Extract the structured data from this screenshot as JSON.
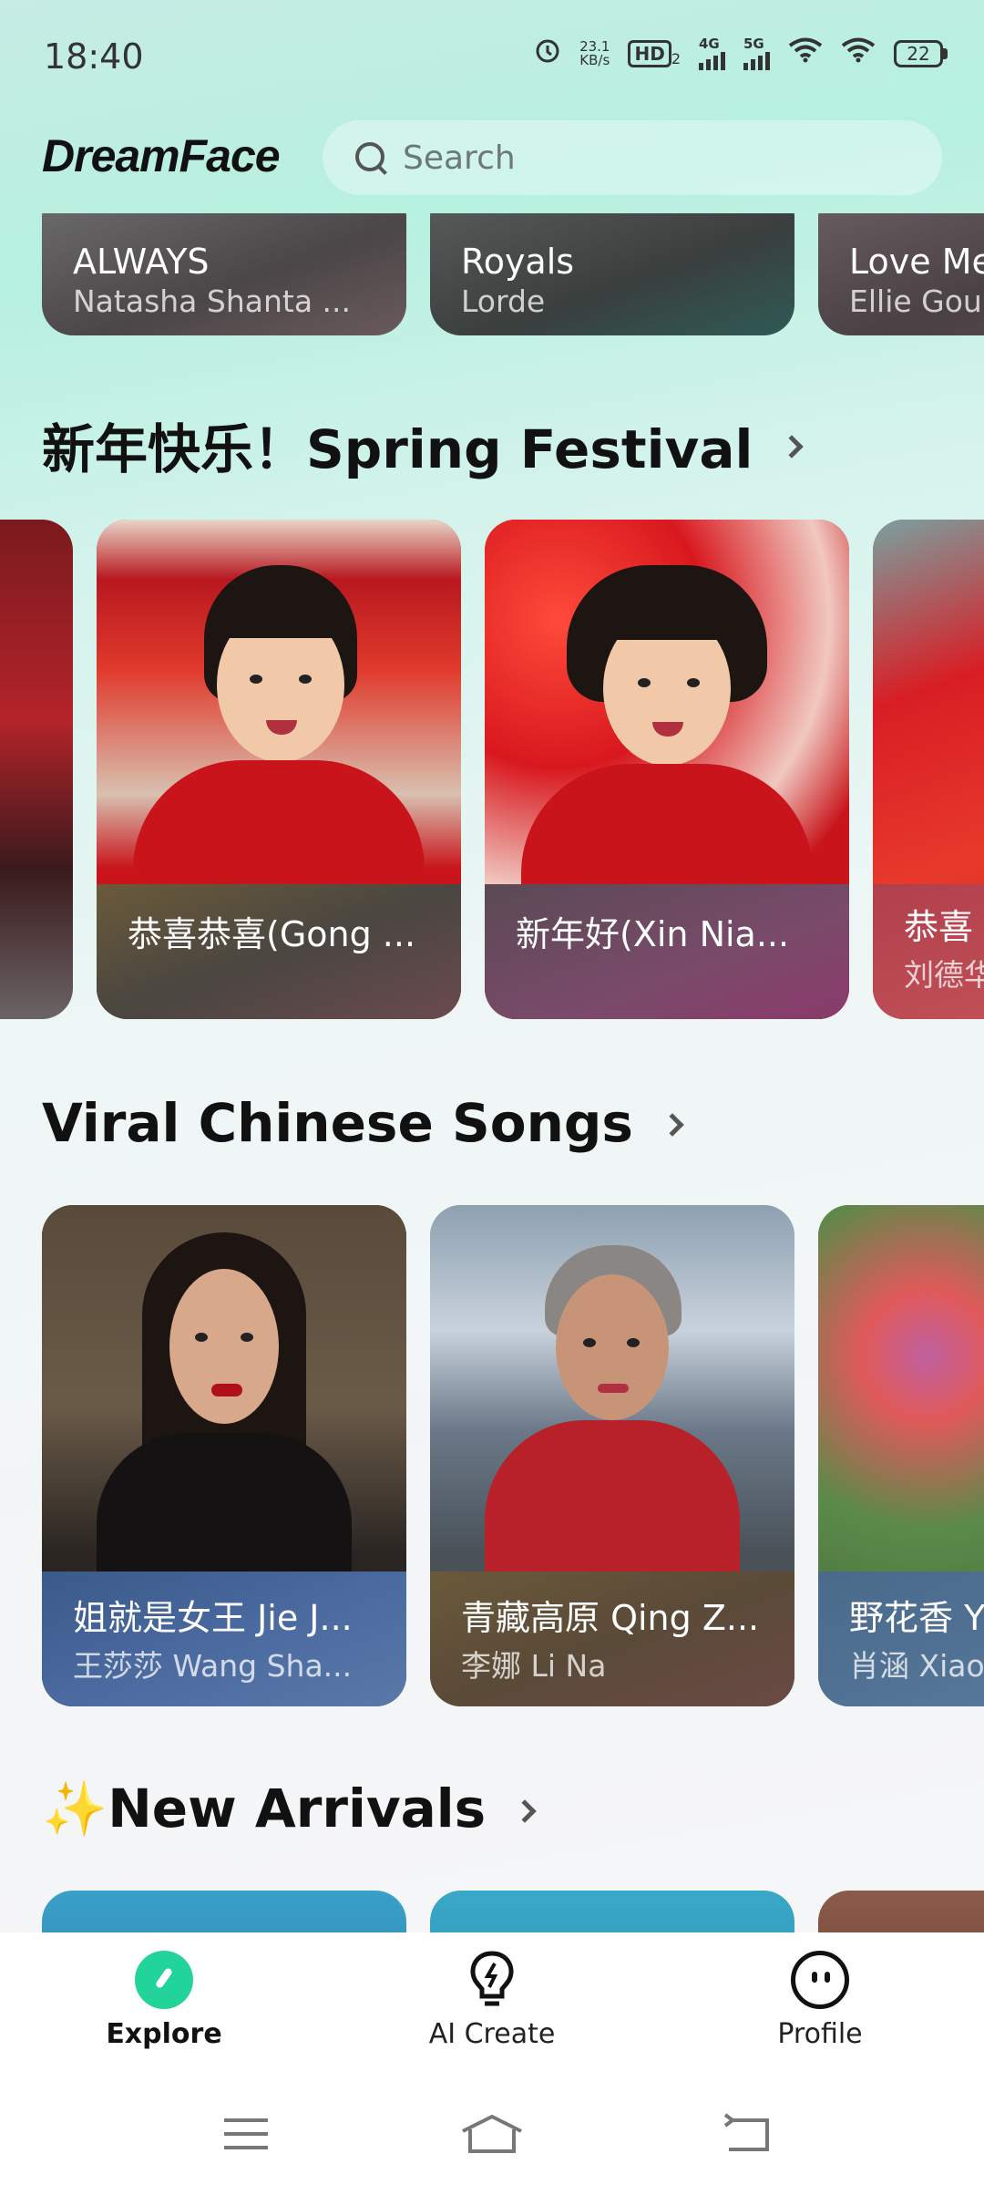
{
  "status_bar": {
    "time": "18:40",
    "net_speed_value": "23.1",
    "net_speed_unit": "KB/s",
    "hd_label": "HD",
    "hd_sub": "2",
    "net_4g": "4G",
    "net_5g": "5G",
    "battery": "22"
  },
  "header": {
    "logo": "DreamFace",
    "search_placeholder": "Search"
  },
  "top_row": [
    {
      "title": "ALWAYS",
      "artist": "Natasha Shanta ..."
    },
    {
      "title": "Royals",
      "artist": "Lorde"
    },
    {
      "title": "Love Me",
      "artist": "Ellie Gou"
    }
  ],
  "sections": {
    "spring": {
      "title": "新年快乐！Spring Festival",
      "cards": [
        {
          "title": "恭喜恭喜(Gong ...",
          "artist": ""
        },
        {
          "title": "新年好(Xin Nia...",
          "artist": ""
        },
        {
          "title": "恭喜",
          "artist": "刘德华"
        }
      ]
    },
    "viral": {
      "title": "Viral Chinese Songs",
      "cards": [
        {
          "title": "姐就是女王 Jie J...",
          "artist": "王莎莎 Wang Sha..."
        },
        {
          "title": "青藏高原 Qing Z...",
          "artist": "李娜 Li Na"
        },
        {
          "title": "野花香 Y",
          "artist": "肖涵 Xiao"
        }
      ]
    },
    "new_arrivals": {
      "title": "✨New Arrivals"
    }
  },
  "bottom_nav": {
    "items": [
      {
        "label": "Explore",
        "icon": "explore-icon",
        "active": true
      },
      {
        "label": "AI Create",
        "icon": "lightbulb-icon",
        "active": false
      },
      {
        "label": "Profile",
        "icon": "face-icon",
        "active": false
      }
    ]
  },
  "colors": {
    "accent": "#22d39a",
    "festival_red": "#c8141a"
  }
}
